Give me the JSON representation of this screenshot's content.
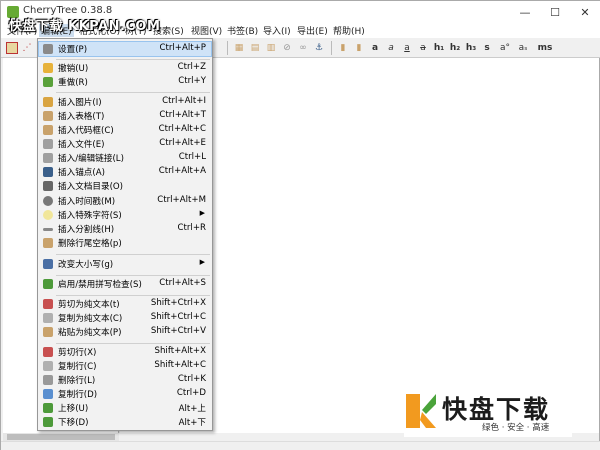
{
  "window": {
    "title": "CherryTree 0.38.8",
    "watermark": "快盘下载 KKPAN.COM",
    "controls": {
      "minimize": "—",
      "maximize": "☐",
      "close": "✕"
    }
  },
  "menubar": [
    {
      "label": "文件(F)"
    },
    {
      "label": "编辑(E)"
    },
    {
      "label": "格式化(O)"
    },
    {
      "label": "树(T)"
    },
    {
      "label": "搜索(S)"
    },
    {
      "label": "视图(V)"
    },
    {
      "label": "书签(B)"
    },
    {
      "label": "导入(I)"
    },
    {
      "label": "导出(E)"
    },
    {
      "label": "帮助(H)"
    }
  ],
  "toolbar": {
    "icons": [
      "node-icon",
      "subnode-icon",
      "image-icon",
      "table-icon",
      "codebox-icon",
      "file-icon",
      "link-icon",
      "anchor-icon",
      "bold-icon",
      "italic-icon",
      "underline-icon",
      "strikethrough-icon",
      "h1-icon",
      "h2-icon",
      "h3-icon",
      "small-icon",
      "superscript-icon",
      "subscript-icon",
      "monospace-icon"
    ],
    "text_glyphs": {
      "a1": "a",
      "a2": "a",
      "a3": "a",
      "h1": "h₁",
      "h2": "h₂",
      "h3": "h₃",
      "s": "s",
      "sup": "a°",
      "sub": "aₛ",
      "ms": "ms"
    }
  },
  "dropdown": {
    "items": [
      {
        "label": "设置(P)",
        "shortcut": "Ctrl+Alt+P",
        "icon": "settings-icon",
        "color": "#8a8a8a"
      },
      {
        "separator": true
      },
      {
        "label": "撤销(U)",
        "shortcut": "Ctrl+Z",
        "icon": "undo-icon",
        "color": "#e7b23a"
      },
      {
        "label": "重做(R)",
        "shortcut": "Ctrl+Y",
        "icon": "redo-icon",
        "color": "#5aa13a"
      },
      {
        "separator": true
      },
      {
        "label": "插入图片(I)",
        "shortcut": "Ctrl+Alt+I",
        "icon": "insert-image-icon",
        "color": "#d9a441"
      },
      {
        "label": "插入表格(T)",
        "shortcut": "Ctrl+Alt+T",
        "icon": "insert-table-icon",
        "color": "#c9a26b"
      },
      {
        "label": "插入代码框(C)",
        "shortcut": "Ctrl+Alt+C",
        "icon": "insert-codebox-icon",
        "color": "#c9a26b"
      },
      {
        "label": "插入文件(E)",
        "shortcut": "Ctrl+Alt+E",
        "icon": "insert-file-icon",
        "color": "#a0a0a0"
      },
      {
        "label": "插入/编辑链接(L)",
        "shortcut": "Ctrl+L",
        "icon": "link-icon",
        "color": "#a0a0a0"
      },
      {
        "label": "插入锚点(A)",
        "shortcut": "Ctrl+Alt+A",
        "icon": "anchor-icon",
        "color": "#3a5f8a"
      },
      {
        "label": "插入文档目录(O)",
        "shortcut": "",
        "icon": "toc-icon",
        "color": "#666666"
      },
      {
        "label": "插入时间戳(M)",
        "shortcut": "Ctrl+Alt+M",
        "icon": "clock-icon",
        "color": "#777777"
      },
      {
        "label": "插入特殊字符(S)",
        "shortcut": "",
        "submenu": true,
        "icon": "special-char-icon",
        "color": "#f1e69a"
      },
      {
        "label": "插入分割线(H)",
        "shortcut": "Ctrl+R",
        "icon": "horizontal-rule-icon",
        "color": "#888888"
      },
      {
        "label": "删除行尾空格(p)",
        "shortcut": "",
        "icon": "strip-spaces-icon",
        "color": "#c9a26b"
      },
      {
        "separator": true
      },
      {
        "label": "改变大小写(g)",
        "shortcut": "",
        "submenu": true,
        "icon": "change-case-icon",
        "color": "#4a6fa5"
      },
      {
        "separator": true
      },
      {
        "label": "启用/禁用拼写检查(S)",
        "shortcut": "Ctrl+Alt+S",
        "icon": "spellcheck-icon",
        "color": "#4d9a3a"
      },
      {
        "separator": true
      },
      {
        "label": "剪切为纯文本(t)",
        "shortcut": "Shift+Ctrl+X",
        "icon": "cut-plain-icon",
        "color": "#c85050"
      },
      {
        "label": "复制为纯文本(C)",
        "shortcut": "Shift+Ctrl+C",
        "icon": "copy-plain-icon",
        "color": "#b0b0b0"
      },
      {
        "label": "粘贴为纯文本(P)",
        "shortcut": "Shift+Ctrl+V",
        "icon": "paste-plain-icon",
        "color": "#c9a26b"
      },
      {
        "separator": true
      },
      {
        "label": "剪切行(X)",
        "shortcut": "Shift+Alt+X",
        "icon": "cut-row-icon",
        "color": "#c85050"
      },
      {
        "label": "复制行(C)",
        "shortcut": "Shift+Alt+C",
        "icon": "copy-row-icon",
        "color": "#b0b0b0"
      },
      {
        "label": "删除行(L)",
        "shortcut": "Ctrl+K",
        "icon": "delete-row-icon",
        "color": "#999999"
      },
      {
        "label": "复制行(D)",
        "shortcut": "Ctrl+D",
        "icon": "duplicate-row-icon",
        "color": "#5a8fd0"
      },
      {
        "label": "上移(U)",
        "shortcut": "Alt+上",
        "icon": "move-up-icon",
        "color": "#4d9a3a"
      },
      {
        "label": "下移(D)",
        "shortcut": "Alt+下",
        "icon": "move-down-icon",
        "color": "#4d9a3a"
      }
    ]
  },
  "logo": {
    "main": "快盘下载",
    "sub": "绿色 · 安全 · 高速",
    "colors": {
      "k_orange": "#f29a1f",
      "k_green": "#4aa33a"
    }
  }
}
